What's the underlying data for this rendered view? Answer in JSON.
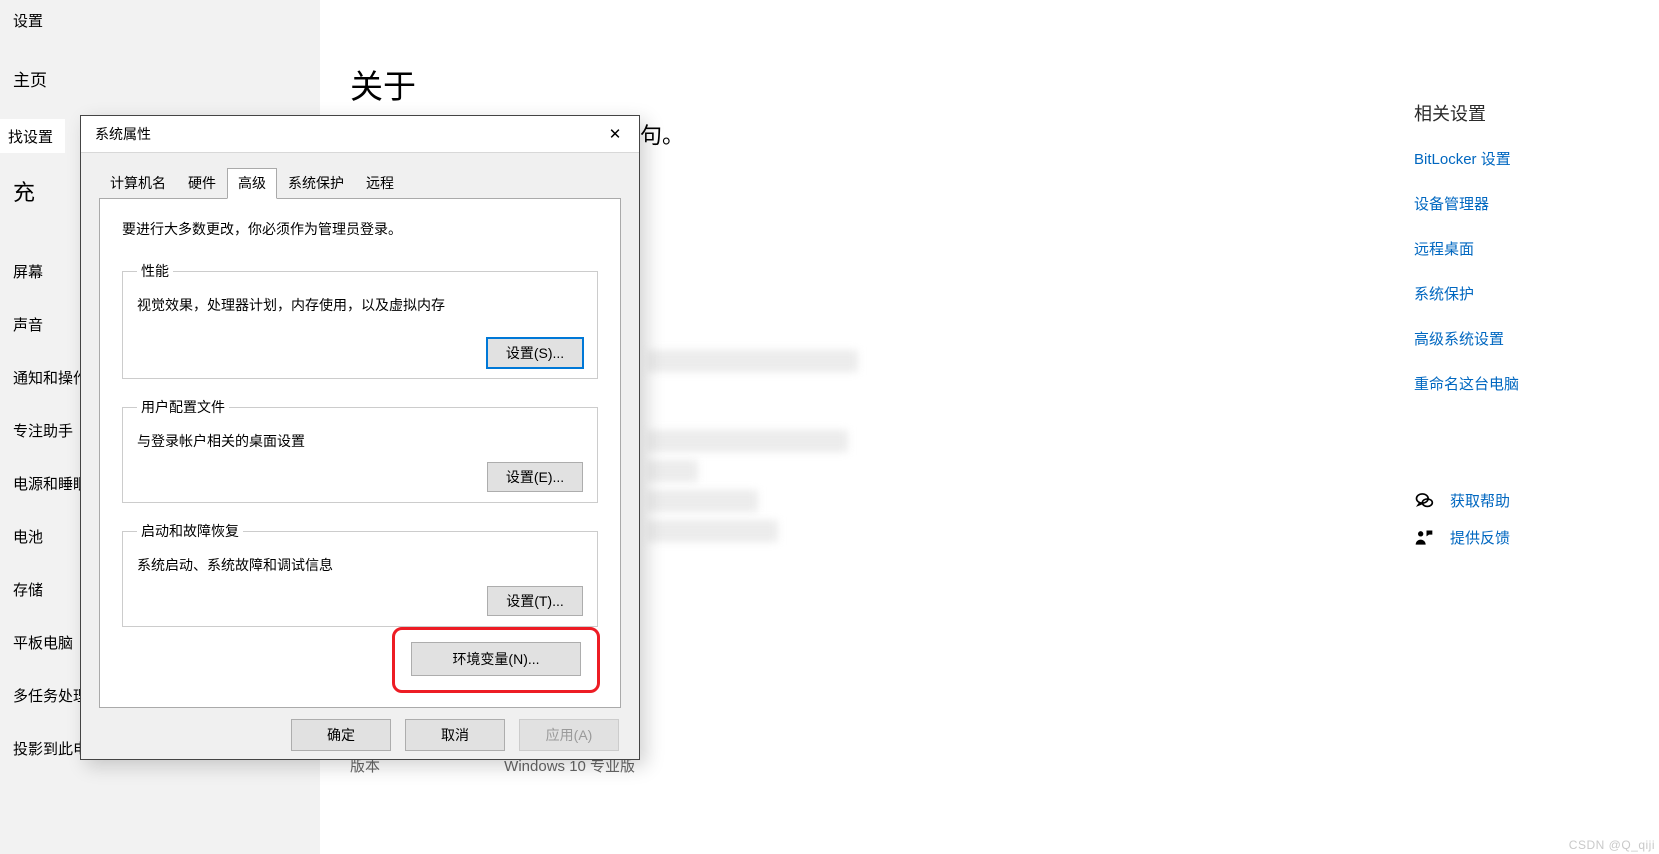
{
  "sidebar": {
    "settings_label": "设置",
    "home_label": "主页",
    "search_label": "找设置",
    "category_partial": "充",
    "items": [
      {
        "label": "屏幕"
      },
      {
        "label": "声音"
      },
      {
        "label": "通知和操作"
      },
      {
        "label": "专注助手"
      },
      {
        "label": "电源和睡眠"
      },
      {
        "label": "电池"
      },
      {
        "label": "存储"
      },
      {
        "label": "平板电脑"
      },
      {
        "label": "多任务处理"
      },
      {
        "label": "投影到此电"
      }
    ]
  },
  "main": {
    "heading": "关于",
    "trailing_glyph": "句。",
    "version_label": "版本",
    "version_value": "Windows 10 专业版"
  },
  "dialog": {
    "title": "系统属性",
    "tabs": [
      {
        "label": "计算机名"
      },
      {
        "label": "硬件"
      },
      {
        "label": "高级"
      },
      {
        "label": "系统保护"
      },
      {
        "label": "远程"
      }
    ],
    "active_tab": 2,
    "admin_note": "要进行大多数更改，你必须作为管理员登录。",
    "groups": {
      "performance": {
        "legend": "性能",
        "desc": "视觉效果，处理器计划，内存使用，以及虚拟内存",
        "button": "设置(S)..."
      },
      "profiles": {
        "legend": "用户配置文件",
        "desc": "与登录帐户相关的桌面设置",
        "button": "设置(E)..."
      },
      "startup": {
        "legend": "启动和故障恢复",
        "desc": "系统启动、系统故障和调试信息",
        "button": "设置(T)..."
      }
    },
    "env_button": "环境变量(N)...",
    "footer": {
      "ok": "确定",
      "cancel": "取消",
      "apply": "应用(A)"
    }
  },
  "right": {
    "heading": "相关设置",
    "links": [
      {
        "label": "BitLocker 设置"
      },
      {
        "label": "设备管理器"
      },
      {
        "label": "远程桌面"
      },
      {
        "label": "系统保护"
      },
      {
        "label": "高级系统设置"
      },
      {
        "label": "重命名这台电脑"
      }
    ],
    "help": "获取帮助",
    "feedback": "提供反馈"
  },
  "watermark": "CSDN @Q_qiji"
}
